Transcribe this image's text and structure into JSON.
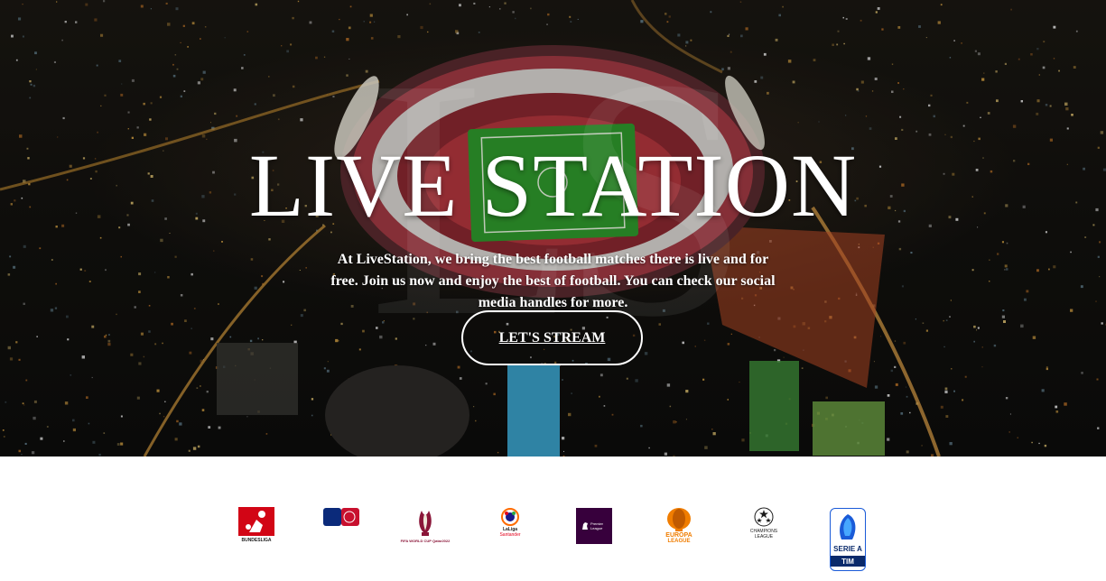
{
  "hero": {
    "title": "LIVE STATION",
    "watermark": "LS",
    "description": "At LiveStation, we bring the best football matches there is live and for free. Join us now and enjoy the best of football. You can check our social media handles for more.",
    "cta_label": "LET'S STREAM"
  },
  "leagues": [
    {
      "name": "Bundesliga",
      "caption": "BUNDESLIGA",
      "color": "#d20515"
    },
    {
      "name": "The Emirates FA Cup",
      "caption": "",
      "color": "#0b2a7a"
    },
    {
      "name": "FIFA World Cup Qatar 2022",
      "caption": "FIFA WORLD CUP Qatar2022",
      "color": "#8a1538"
    },
    {
      "name": "LaLiga Santander",
      "caption": "LaLiga",
      "caption2": "Santander",
      "color": "#e3001b"
    },
    {
      "name": "Premier League",
      "caption": "Premier League",
      "color": "#37003c"
    },
    {
      "name": "UEFA Europa League",
      "caption": "EUROPA",
      "caption2": "LEAGUE",
      "color": "#f07d00"
    },
    {
      "name": "UEFA Champions League",
      "caption": "CHAMPIONS",
      "caption2": "LEAGUE",
      "color": "#1a1a1a"
    },
    {
      "name": "Serie A TIM",
      "caption": "SERIE A",
      "caption2": "TIM",
      "color": "#1a5bd8"
    }
  ]
}
